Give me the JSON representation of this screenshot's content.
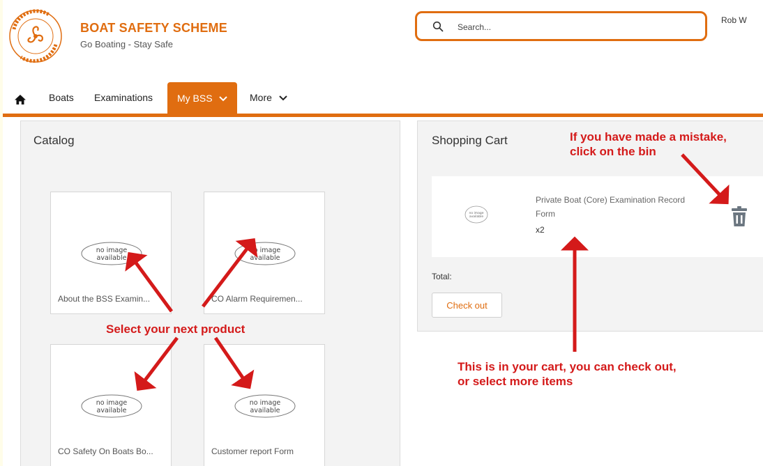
{
  "brand": {
    "logo_text": "BOAT SAFETY SCHEME · GO BOATING · STAY SAFE",
    "title": "BOAT SAFETY SCHEME",
    "tagline": "Go Boating - Stay Safe"
  },
  "search": {
    "placeholder": "Search..."
  },
  "user": {
    "name": "Rob W"
  },
  "nav": {
    "items": [
      {
        "label": "Boats"
      },
      {
        "label": "Examinations"
      },
      {
        "label": "My BSS",
        "active": true
      },
      {
        "label": "More"
      }
    ]
  },
  "catalog": {
    "title": "Catalog",
    "no_image_text": [
      "no image",
      "available"
    ],
    "products": [
      {
        "label": "About the BSS Examin..."
      },
      {
        "label": "CO Alarm Requiremen..."
      },
      {
        "label": "CO Safety On Boats Bo..."
      },
      {
        "label": "Customer report Form"
      }
    ]
  },
  "cart": {
    "title": "Shopping Cart",
    "thumb_text": [
      "no image",
      "available"
    ],
    "item": {
      "name": "Private Boat (Core) Examination Record Form",
      "quantity": "x2"
    },
    "total_label": "Total:",
    "checkout_label": "Check out"
  },
  "annotations": {
    "mistake": [
      "If you have made a mistake,",
      "click on the bin"
    ],
    "select": "Select your next product",
    "incart": [
      "This is in your cart, you can check out,",
      "or select more items"
    ]
  },
  "colors": {
    "brand": "#e06d10",
    "annotation": "#d41a1a",
    "trash": "#6b7680"
  },
  "icons": [
    "logo-icon",
    "search-icon",
    "home-icon",
    "chevron-down-icon",
    "trash-icon"
  ]
}
